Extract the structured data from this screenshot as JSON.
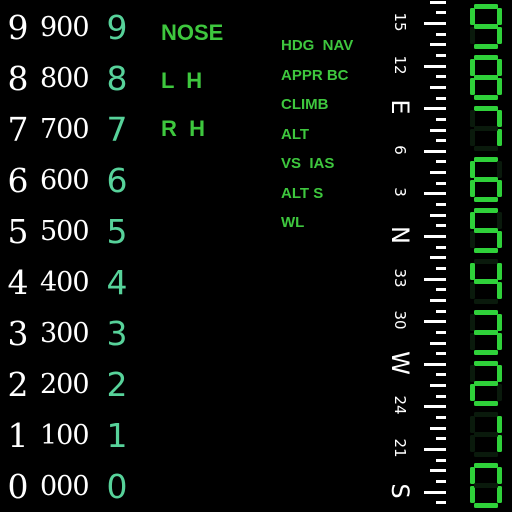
{
  "digits_col1": [
    "9",
    "8",
    "7",
    "6",
    "5",
    "4",
    "3",
    "2",
    "1",
    "0"
  ],
  "digits_col2": [
    "900",
    "800",
    "700",
    "600",
    "500",
    "400",
    "300",
    "200",
    "100",
    "000"
  ],
  "digits_col3": [
    "9",
    "8",
    "7",
    "6",
    "5",
    "4",
    "3",
    "2",
    "1",
    "0"
  ],
  "annunciators": {
    "nose": "NOSE",
    "lh": "L  H",
    "rh": "R  H"
  },
  "mode_labels": [
    "HDG  NAV",
    "APPR BC",
    "CLIMB",
    "ALT",
    "VS  IAS",
    "ALT S",
    "WL"
  ],
  "heading_tape": [
    "15",
    "12",
    "E",
    "6",
    "3",
    "N",
    "33",
    "30",
    "W",
    "24",
    "21",
    "S"
  ],
  "seven_segment_digits": [
    "9",
    "8",
    "7",
    "6",
    "5",
    "4",
    "3",
    "2",
    "1",
    "0"
  ],
  "colors": {
    "background": "#000000",
    "white_numerals": "#ffffff",
    "teal_numerals": "#57d29a",
    "annunciator_green": "#3ec73e",
    "segment_green": "#2fd13a"
  }
}
